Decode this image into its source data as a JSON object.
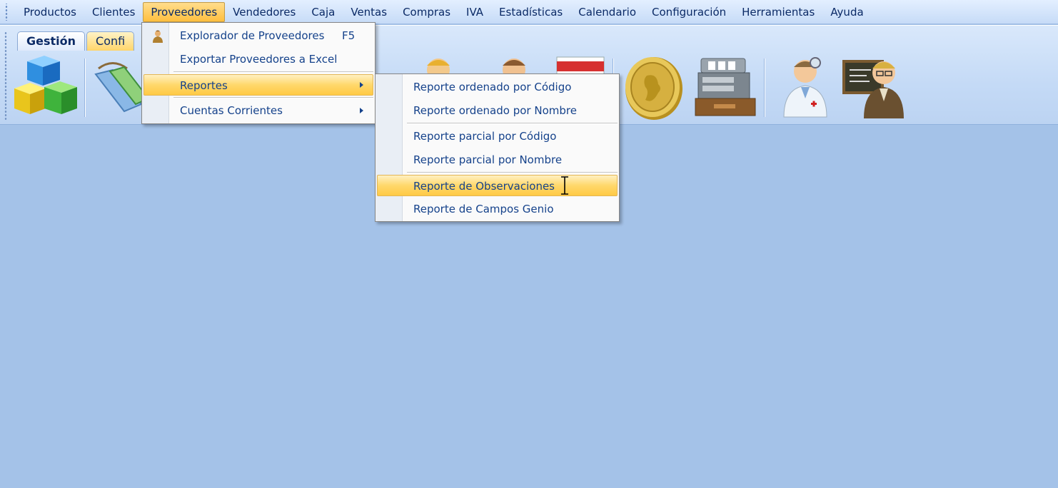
{
  "menubar": {
    "items": [
      "Productos",
      "Clientes",
      "Proveedores",
      "Vendedores",
      "Caja",
      "Ventas",
      "Compras",
      "IVA",
      "Estadísticas",
      "Calendario",
      "Configuración",
      "Herramientas",
      "Ayuda"
    ],
    "active": "Proveedores"
  },
  "ribbon": {
    "tabs": [
      "Gestión",
      "Confi"
    ],
    "icons": [
      "cubes-icon",
      "tags-icon",
      "person-icon",
      "person2-icon",
      "calendar-icon",
      "coin-icon",
      "cash-register-icon",
      "doctor-icon",
      "teacher-icon"
    ]
  },
  "proveedores_menu": {
    "items": [
      {
        "label": "Explorador de Proveedores",
        "shortcut": "F5"
      },
      {
        "label": "Exportar Proveedores a Excel"
      },
      {
        "label": "Reportes"
      },
      {
        "label": "Cuentas Corrientes"
      }
    ]
  },
  "reportes_menu": {
    "items": [
      {
        "label": "Reporte ordenado por Código"
      },
      {
        "label": "Reporte ordenado por Nombre"
      },
      {
        "label": "Reporte parcial por Código"
      },
      {
        "label": "Reporte parcial por Nombre"
      },
      {
        "label": "Reporte de Observaciones"
      },
      {
        "label": "Reporte de Campos Genio"
      }
    ]
  },
  "colors": {
    "workspace": "#a4c2e8",
    "highlight": "#ffd86b",
    "menu_text": "#15428b"
  }
}
